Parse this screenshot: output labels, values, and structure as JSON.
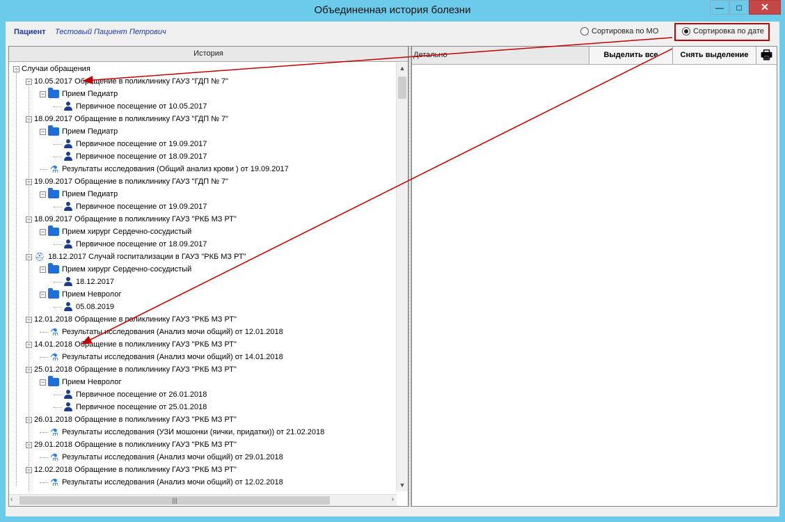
{
  "window": {
    "title": "Объединенная история болезни",
    "minimize": "—",
    "maximize": "□",
    "close": "✕"
  },
  "patient": {
    "label": "Пациент",
    "name": "Тестовый Пациент Петрович"
  },
  "sorting": {
    "by_mo": "Сортировка по МО",
    "by_date": "Сортировка по дате",
    "selected": "by_date"
  },
  "left": {
    "header": "История"
  },
  "right": {
    "header": "Детально",
    "select_all": "Выделить все",
    "clear_selection": "Снять выделение"
  },
  "tree": [
    {
      "level": 0,
      "kind": "root",
      "text": "Случаи обращения"
    },
    {
      "level": 1,
      "kind": "case",
      "text": "10.05.2017  Обращение в поликлинику ГАУЗ \"ГДП № 7\""
    },
    {
      "level": 2,
      "kind": "folder",
      "text": "Прием Педиатр"
    },
    {
      "level": 3,
      "kind": "person",
      "text": "Первичное посещение от 10.05.2017"
    },
    {
      "level": 1,
      "kind": "case",
      "text": "18.09.2017  Обращение в поликлинику ГАУЗ \"ГДП № 7\""
    },
    {
      "level": 2,
      "kind": "folder",
      "text": "Прием Педиатр"
    },
    {
      "level": 3,
      "kind": "person",
      "text": "Первичное посещение от 19.09.2017"
    },
    {
      "level": 3,
      "kind": "person",
      "text": "Первичное посещение от 18.09.2017"
    },
    {
      "level": 2,
      "kind": "lab",
      "text": "Результаты исследования (Общий анализ крови ) от 19.09.2017"
    },
    {
      "level": 1,
      "kind": "case",
      "text": "19.09.2017  Обращение в поликлинику ГАУЗ \"ГДП № 7\""
    },
    {
      "level": 2,
      "kind": "folder",
      "text": "Прием Педиатр"
    },
    {
      "level": 3,
      "kind": "person",
      "text": "Первичное посещение от 19.09.2017"
    },
    {
      "level": 1,
      "kind": "case",
      "text": "18.09.2017  Обращение в поликлинику ГАУЗ \"РКБ МЗ РТ\""
    },
    {
      "level": 2,
      "kind": "folder",
      "text": "Прием хирург Сердечно-сосудистый"
    },
    {
      "level": 3,
      "kind": "person",
      "text": "Первичное посещение от 18.09.2017"
    },
    {
      "level": 1,
      "kind": "hosp",
      "text": "18.12.2017  Случай госпитализации в ГАУЗ \"РКБ МЗ РТ\""
    },
    {
      "level": 2,
      "kind": "folder",
      "text": "Прием хирург Сердечно-сосудистый"
    },
    {
      "level": 3,
      "kind": "person",
      "text": " 18.12.2017"
    },
    {
      "level": 2,
      "kind": "folder",
      "text": "Прием Невролог"
    },
    {
      "level": 3,
      "kind": "person",
      "text": " 05.08.2019"
    },
    {
      "level": 1,
      "kind": "case",
      "text": "12.01.2018  Обращение в поликлинику ГАУЗ \"РКБ МЗ РТ\""
    },
    {
      "level": 2,
      "kind": "lab",
      "text": "Результаты исследования (Анализ мочи общий) от 12.01.2018"
    },
    {
      "level": 1,
      "kind": "case",
      "text": "14.01.2018  Обращение в поликлинику ГАУЗ \"РКБ МЗ РТ\""
    },
    {
      "level": 2,
      "kind": "lab",
      "text": "Результаты исследования (Анализ мочи общий) от 14.01.2018"
    },
    {
      "level": 1,
      "kind": "case",
      "text": "25.01.2018  Обращение в поликлинику ГАУЗ \"РКБ МЗ РТ\""
    },
    {
      "level": 2,
      "kind": "folder",
      "text": "Прием Невролог"
    },
    {
      "level": 3,
      "kind": "person",
      "text": "Первичное посещение от 26.01.2018"
    },
    {
      "level": 3,
      "kind": "person",
      "text": "Первичное посещение от 25.01.2018"
    },
    {
      "level": 1,
      "kind": "case",
      "text": "26.01.2018  Обращение в поликлинику ГАУЗ \"РКБ МЗ РТ\""
    },
    {
      "level": 2,
      "kind": "lab",
      "text": "Результаты исследования (УЗИ мошонки (яички, придатки)) от 21.02.2018"
    },
    {
      "level": 1,
      "kind": "case",
      "text": "29.01.2018  Обращение в поликлинику ГАУЗ \"РКБ МЗ РТ\""
    },
    {
      "level": 2,
      "kind": "lab",
      "text": "Результаты исследования (Анализ мочи общий) от 29.01.2018"
    },
    {
      "level": 1,
      "kind": "case",
      "text": "12.02.2018  Обращение в поликлинику ГАУЗ \"РКБ МЗ РТ\""
    },
    {
      "level": 2,
      "kind": "lab",
      "text": "Результаты исследования (Анализ мочи общий) от 12.02.2018"
    }
  ],
  "colors": {
    "annotation": "#c00000",
    "window_frame": "#6ccbeb",
    "link_text": "#1a3aa8"
  },
  "icons": {
    "folder": "folder-icon",
    "person": "person-icon",
    "lab": "lab-results-icon",
    "hosp": "hospitalization-icon",
    "print": "printer-icon"
  }
}
